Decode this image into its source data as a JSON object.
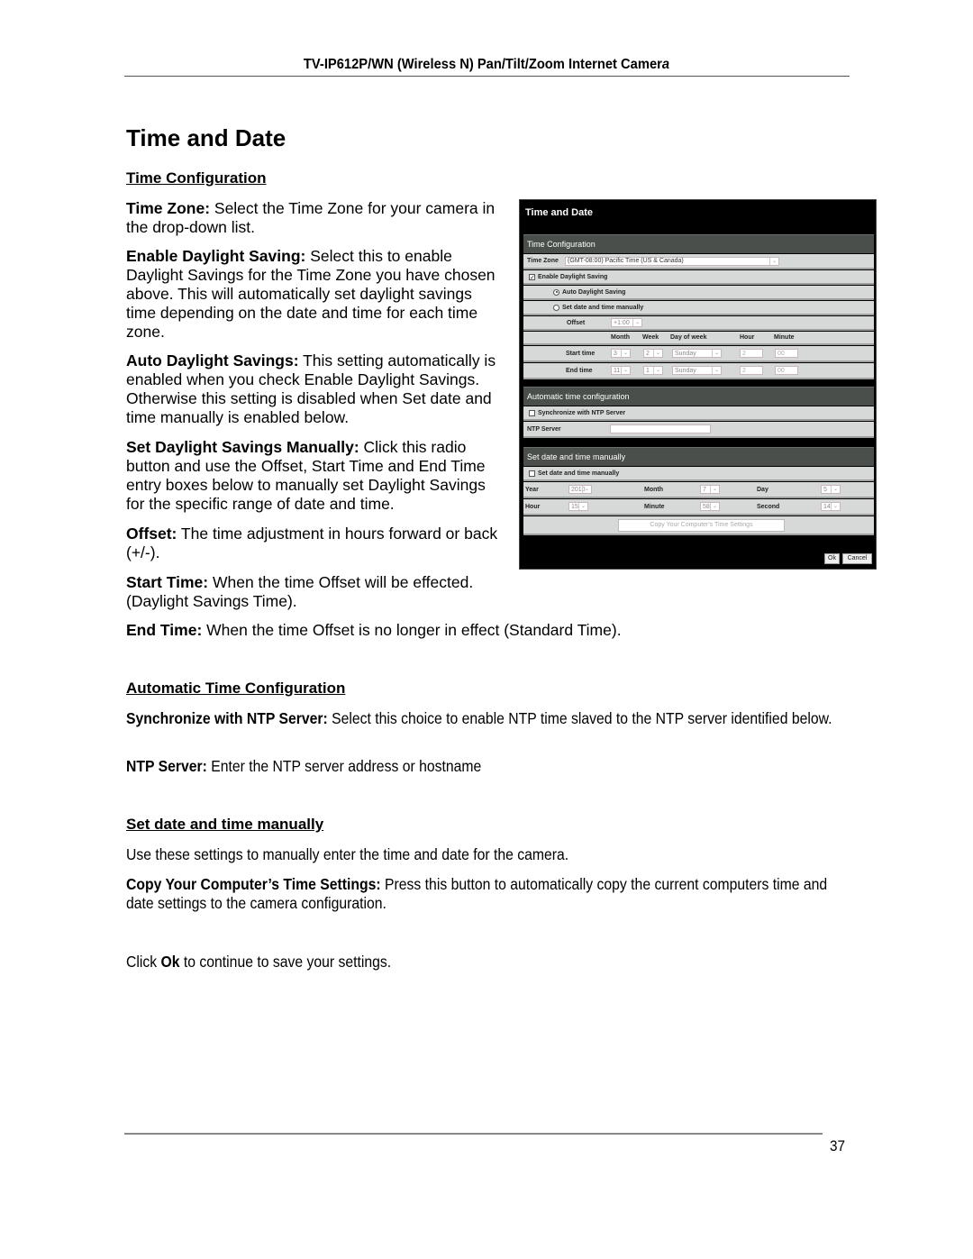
{
  "running_header": {
    "title_main": "TV-IP612P/WN (Wireless N) Pan/Tilt/Zoom Internet Camer",
    "title_last_letter": "a"
  },
  "page_title": "Time and Date",
  "sections": {
    "time_configuration": {
      "heading": "Time Configuration",
      "paragraphs": [
        {
          "term": "Time Zone:",
          "text": " Select the Time Zone for your camera in the drop-down list."
        },
        {
          "term": "Enable Daylight Saving:",
          "text": " Select this to enable Daylight Savings for the Time Zone you have chosen above. This will automatically set daylight savings time depending on the date and time for each time zone."
        },
        {
          "term": "Auto Daylight Savings:",
          "text": " This setting automatically is enabled when you check Enable Daylight Savings. Otherwise this setting is disabled when Set date and time manually is enabled below."
        },
        {
          "term": "Set Daylight Savings Manually:",
          "text": " Click this radio button and use the Offset,  Start Time and End Time entry boxes below to manually set Daylight Savings for the specific range of date and time."
        },
        {
          "term": "Offset:",
          "text": " The time adjustment in hours forward or back (+/-)."
        },
        {
          "term": "Start Time:",
          "text": " When the time Offset will be effected. (Daylight Savings Time)."
        },
        {
          "term": "End Time:",
          "text": " When the time Offset is no longer in effect (Standard Time)."
        }
      ]
    },
    "automatic_time_configuration": {
      "heading": "Automatic Time Configuration",
      "paragraphs": [
        {
          "term": "Synchronize with NTP Server:",
          "text": "  Select this choice to enable NTP time slaved to the NTP server identified below."
        },
        {
          "term": "NTP Server:",
          "text": " Enter the NTP server address or hostname"
        }
      ]
    },
    "set_date_time_manually": {
      "heading": "Set date and time manually",
      "intro": "Use these settings to manually enter the time and date for the camera.",
      "paragraphs": [
        {
          "term": "Copy Your Computer’s Time Settings:",
          "text": " Press this button to automatically copy the current computers time and date settings to the camera configuration."
        }
      ]
    },
    "closing": {
      "prefix": "Click ",
      "bold": "Ok",
      "suffix": " to continue to save your settings."
    }
  },
  "screenshot": {
    "title": "Time and Date",
    "time_config_band": "Time Configuration",
    "time_zone_label": "Time Zone",
    "time_zone_value": "(GMT-08:00) Pacific Time (US & Canada)",
    "enable_dst_label": "Enable Daylight Saving",
    "enable_dst_checked": true,
    "auto_dst_label": "Auto Daylight Saving",
    "manual_dst_label": "Set date and time manually",
    "dst_mode_selected": "Auto Daylight Saving",
    "offset_label": "Offset",
    "offset_value": "+1:00",
    "columns": [
      "Month",
      "Week",
      "Day of week",
      "Hour",
      "Minute"
    ],
    "start_time": {
      "label": "Start time",
      "month": "3",
      "week": "2",
      "day": "Sunday",
      "hour": "2",
      "minute": "00"
    },
    "end_time": {
      "label": "End time",
      "month": "11",
      "week": "1",
      "day": "Sunday",
      "hour": "2",
      "minute": "00"
    },
    "auto_band": "Automatic time configuration",
    "ntp_sync_label": "Synchronize with NTP Server",
    "ntp_sync_checked": false,
    "ntp_server_label": "NTP Server",
    "ntp_server_value": "",
    "manual_band": "Set date and time manually",
    "manual_check_label": "Set date and time manually",
    "manual_checked": false,
    "year_label": "Year",
    "year_value": "2010",
    "month_label": "Month",
    "month_value": "7",
    "day_label": "Day",
    "day_value": "5",
    "hour_label": "Hour",
    "hour_value": "15",
    "minute_label": "Minute",
    "minute_value": "58",
    "second_label": "Second",
    "second_value": "14",
    "copy_button": "Copy Your Computer's Time Settings",
    "ok_button": "Ok",
    "cancel_button": "Cancel",
    "dropdown_glyph": "⌄",
    "check_glyph": "✓"
  },
  "page_number": "37"
}
